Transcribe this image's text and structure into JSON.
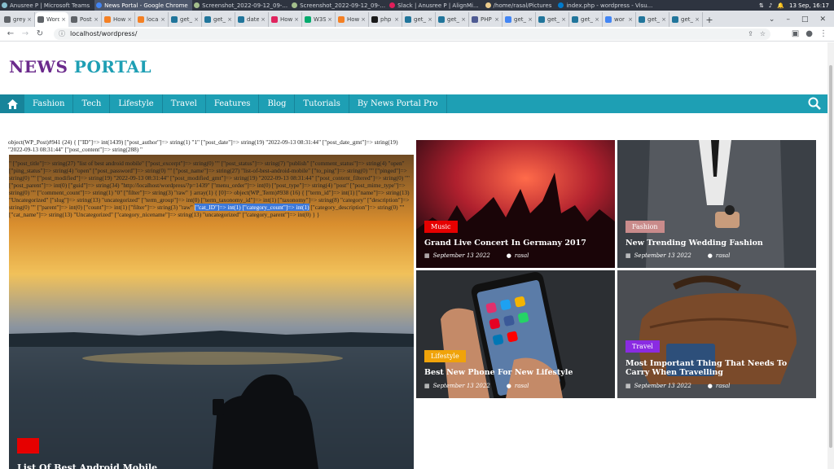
{
  "taskbar": {
    "items": [
      {
        "label": "Anusree P | Microsoft Teams",
        "active": false
      },
      {
        "label": "News Portal - Google Chrome",
        "active": true
      },
      {
        "label": "Screenshot_2022-09-12_09-...",
        "active": false
      },
      {
        "label": "Screenshot_2022-09-12_09-...",
        "active": false
      },
      {
        "label": "Slack | Anusree P | AlignMi...",
        "active": false
      },
      {
        "label": "/home/rasal/Pictures",
        "active": false
      },
      {
        "label": "index.php - wordpress - Visu...",
        "active": false
      }
    ],
    "datetime": "13 Sep, 16:17"
  },
  "tabs": [
    {
      "label": "grey",
      "color": "#5f6368"
    },
    {
      "label": "Word",
      "color": "#5f6368",
      "active": true
    },
    {
      "label": "Post",
      "color": "#5f6368"
    },
    {
      "label": "How",
      "color": "#f48024"
    },
    {
      "label": "local",
      "color": "#f48024"
    },
    {
      "label": "get_",
      "color": "#21759b"
    },
    {
      "label": "get_",
      "color": "#21759b"
    },
    {
      "label": "date",
      "color": "#21759b"
    },
    {
      "label": "How",
      "color": "#e0245e"
    },
    {
      "label": "W3S",
      "color": "#04aa6d"
    },
    {
      "label": "How",
      "color": "#f48024"
    },
    {
      "label": "php",
      "color": "#1a1a1a"
    },
    {
      "label": "get_",
      "color": "#21759b"
    },
    {
      "label": "get_",
      "color": "#21759b"
    },
    {
      "label": "PHP",
      "color": "#4f5b93"
    },
    {
      "label": "get_",
      "color": "#4285f4"
    },
    {
      "label": "get_",
      "color": "#21759b"
    },
    {
      "label": "get_",
      "color": "#21759b"
    },
    {
      "label": "wor",
      "color": "#4285f4"
    },
    {
      "label": "get_",
      "color": "#21759b"
    },
    {
      "label": "get_",
      "color": "#21759b"
    }
  ],
  "address": {
    "url": "localhost/wordpress/"
  },
  "site": {
    "title_part1": "NEWS",
    "title_part2": "PORTAL"
  },
  "nav": {
    "items": [
      "Fashion",
      "Tech",
      "Lifestyle",
      "Travel",
      "Features",
      "Blog",
      "Tutorials",
      "By News Portal Pro"
    ]
  },
  "debug": {
    "top": "object(WP_Post)#941 (24) { [\"ID\"]=> int(1439) [\"post_author\"]=> string(1) \"1\" [\"post_date\"]=> string(19) \"2022-09-13 08:31:44\" [\"post_date_gmt\"]=> string(19) \"2022-09-13 08:31:44\" [\"post_content\"]=> string(288) \"",
    "main_before": "\" [\"post_title\"]=> string(27) \"list of best android mobile\" [\"post_excerpt\"]=> string(0) \"\" [\"post_status\"]=> string(7) \"publish\" [\"comment_status\"]=> string(4) \"open\" [\"ping_status\"]=> string(4) \"open\" [\"post_password\"]=> string(0) \"\" [\"post_name\"]=> string(27) \"list-of-best-android-mobile\" [\"to_ping\"]=> string(0) \"\" [\"pinged\"]=> string(0) \"\" [\"post_modified\"]=> string(19) \"2022-09-13 08:31:44\" [\"post_modified_gmt\"]=> string(19) \"2022-09-13 08:31:44\" [\"post_content_filtered\"]=> string(0) \"\" [\"post_parent\"]=> int(0) [\"guid\"]=> string(34) \"http://localhost/wordpress/?p=1439\" [\"menu_order\"]=> int(0) [\"post_type\"]=> string(4) \"post\" [\"post_mime_type\"]=> string(0) \"\" [\"comment_count\"]=> string(1) \"0\" [\"filter\"]=> string(3) \"raw\" } array(1) { [0]=> object(WP_Term)#938 (16) { [\"term_id\"]=> int(1) [\"name\"]=> string(13) \"Uncategorized\" [\"slug\"]=> string(13) \"uncategorized\" [\"term_group\"]=> int(0) [\"term_taxonomy_id\"]=> int(1) [\"taxonomy\"]=> string(8) \"category\" [\"description\"]=> string(0) \"\" [\"parent\"]=> int(0) [\"count\"]=> int(1) [\"filter\"]=> string(3) \"raw\" ",
    "highlight": "[\"cat_ID\"]=> int(1) [\"category_count\"]=> int(1)",
    "main_after": " [\"category_description\"]=> string(0) \"\" [\"cat_name\"]=> string(13) \"Uncategorized\" [\"category_nicename\"]=> string(13) \"uncategorized\" [\"category_parent\"]=> int(0) } }"
  },
  "hero": {
    "title": "List Of Best Android Mobile",
    "category_color": "#e60000"
  },
  "cards": [
    {
      "category": "Music",
      "category_color": "#e60000",
      "title": "Grand Live Concert In Germany 2017",
      "date": "September 13 2022",
      "author": "rasal"
    },
    {
      "category": "Fashion",
      "category_color": "#c98b8b",
      "title": "New Trending Wedding Fashion",
      "date": "September 13 2022",
      "author": "rasal"
    },
    {
      "category": "Lifestyle",
      "category_color": "#f0a30a",
      "title": "Best New Phone For New Lifestyle",
      "date": "September 13 2022",
      "author": "rasal"
    },
    {
      "category": "Travel",
      "category_color": "#8a2be2",
      "title": "Most Important Thing That Needs To Carry When Travelling",
      "date": "September 13 2022",
      "author": "rasal"
    }
  ],
  "colors": {
    "brand_purple": "#6b2a8c",
    "brand_teal": "#1e9fb4",
    "nav_dark": "#17849a"
  }
}
